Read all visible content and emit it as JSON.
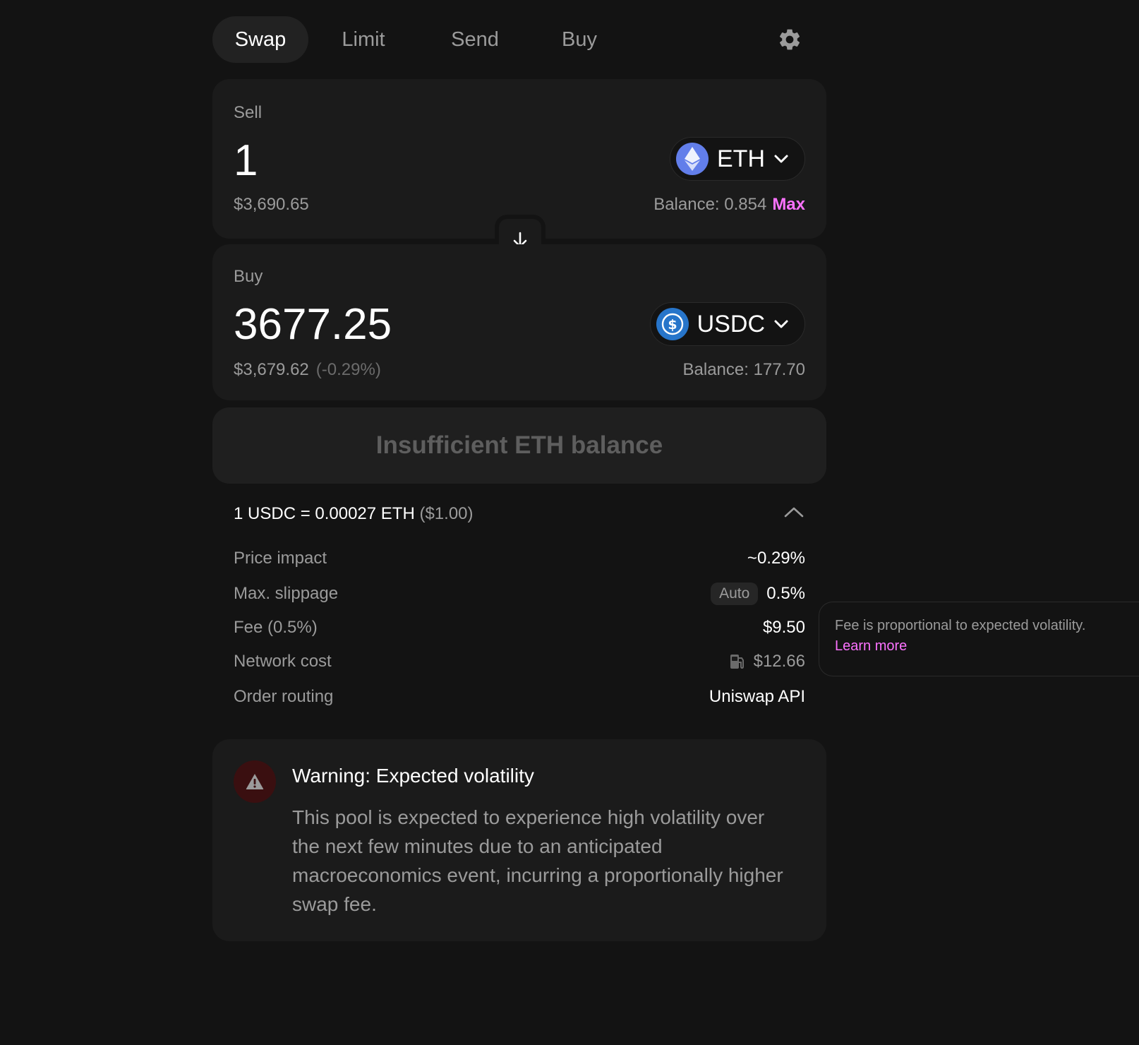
{
  "tabs": {
    "swap": "Swap",
    "limit": "Limit",
    "send": "Send",
    "buy": "Buy"
  },
  "sell": {
    "label": "Sell",
    "amount": "1",
    "usd_value": "$3,690.65",
    "token": "ETH",
    "balance": "Balance: 0.854",
    "max_label": "Max"
  },
  "buy": {
    "label": "Buy",
    "amount": "3677.25",
    "usd_value": "$3,679.62",
    "usd_change": "(-0.29%)",
    "token": "USDC",
    "balance": "Balance: 177.70"
  },
  "action_button": "Insufficient ETH balance",
  "details": {
    "rate": "1 USDC = 0.00027 ETH",
    "rate_usd": "($1.00)",
    "price_impact_label": "Price impact",
    "price_impact_value": "~0.29%",
    "slippage_label": "Max. slippage",
    "slippage_badge": "Auto",
    "slippage_value": "0.5%",
    "fee_label": "Fee (0.5%)",
    "fee_value": "$9.50",
    "network_cost_label": "Network cost",
    "network_cost_value": "$12.66",
    "routing_label": "Order routing",
    "routing_value": "Uniswap API"
  },
  "tooltip": {
    "text": "Fee is proportional to expected volatility.",
    "link": "Learn more"
  },
  "warning": {
    "title": "Warning: Expected volatility",
    "body": "This pool is expected to experience high volatility over the next few minutes due to an anticipated macroeconomics event, incurring a proportionally higher swap fee."
  },
  "colors": {
    "background": "#131313",
    "panel": "#1b1b1b",
    "accent": "#fc72ff",
    "eth_logo": "#627eea",
    "usdc_logo": "#2775ca",
    "warning_bg": "#3a0f10"
  },
  "icons": {
    "settings": "gear-icon",
    "token_dropdown": "chevron-down-icon",
    "flip": "arrow-down-icon",
    "collapse": "chevron-up-icon",
    "network_cost": "gas-pump-icon",
    "warning": "warning-triangle-icon"
  }
}
